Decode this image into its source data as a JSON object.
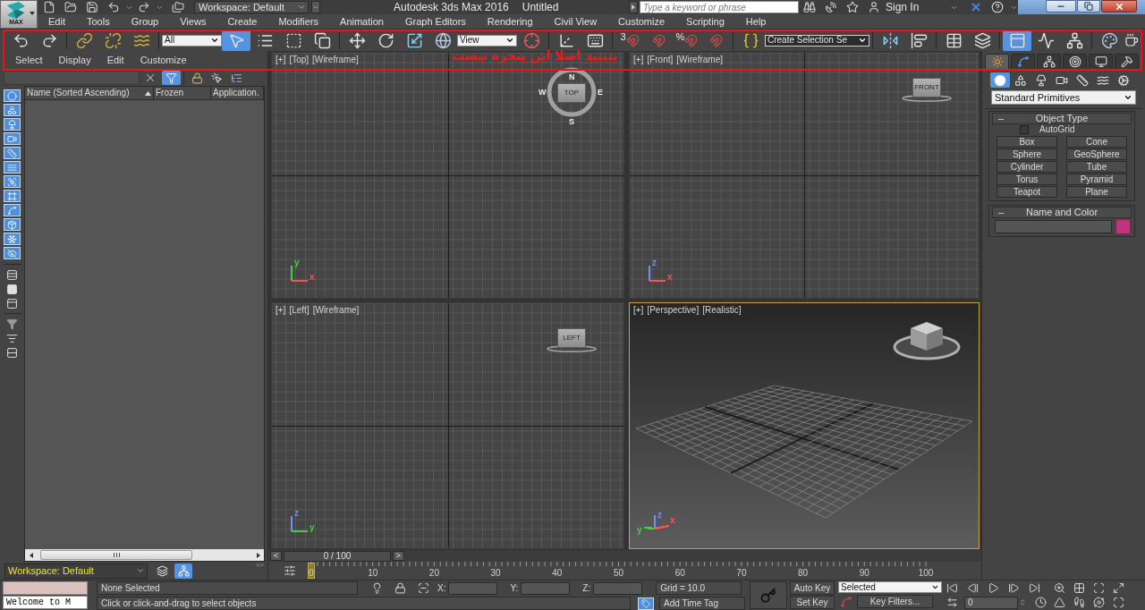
{
  "app_button": {
    "label": "MAX"
  },
  "quick_access": {
    "workspace": "Workspace: Default"
  },
  "title": {
    "app": "Autodesk 3ds Max 2016",
    "document": "Untitled"
  },
  "search": {
    "placeholder": "Type a keyword or phrase"
  },
  "account": {
    "label": "Sign In"
  },
  "menu": [
    "Edit",
    "Tools",
    "Group",
    "Views",
    "Create",
    "Modifiers",
    "Animation",
    "Graph Editors",
    "Rendering",
    "Civil View",
    "Customize",
    "Scripting",
    "Help"
  ],
  "main_toolbar": {
    "tools": [
      {
        "on": false
      },
      {
        "on": false
      },
      {
        "on": false
      },
      {
        "on": false
      },
      {
        "on": false
      },
      {
        "on": true
      },
      {
        "on": false
      },
      {
        "on": false
      },
      {
        "on": false
      },
      {
        "on": false
      },
      {
        "on": false
      },
      {
        "on": false
      },
      {
        "on": false
      },
      {
        "on": false
      },
      {
        "on": false
      },
      {
        "on": false
      },
      {
        "on": false,
        "glyph": "3"
      },
      {
        "on": false
      },
      {
        "on": false,
        "glyph": "%"
      },
      {
        "on": false
      },
      {
        "on": false
      },
      {
        "on": false
      },
      {
        "on": false
      },
      {
        "on": false
      },
      {
        "on": false
      },
      {
        "on": true
      },
      {
        "on": false
      },
      {
        "on": false
      },
      {
        "on": false
      },
      {
        "on": false
      }
    ],
    "dropdowns": [
      "All",
      "View",
      "Create Selection Se"
    ]
  },
  "annotation": {
    "text": "ببینید اصلا این پنجره نیست"
  },
  "scene_explorer": {
    "menu": [
      "Select",
      "Display",
      "Edit",
      "Customize"
    ],
    "tools": [
      {
        "on": false
      },
      {
        "on": true
      },
      {
        "on": false
      },
      {
        "on": false
      },
      {
        "on": false
      }
    ],
    "filters": [
      {
        "on": true
      },
      {
        "on": true
      },
      {
        "on": true
      },
      {
        "on": true
      },
      {
        "on": true
      },
      {
        "on": true
      },
      {
        "on": true
      },
      {
        "on": true
      },
      {
        "on": true
      },
      {
        "on": true
      },
      {
        "on": true
      },
      {
        "on": true
      }
    ],
    "columns": [
      "Name (Sorted Ascending)",
      "Frozen",
      "Application."
    ],
    "workspace": "Workspace: Default",
    "workspace_tools": [
      {
        "on": false
      },
      {
        "on": true
      }
    ],
    "expand": ">>"
  },
  "viewports": [
    {
      "labels": [
        "[+]",
        "[Top]",
        "[Wireframe]"
      ],
      "kind": "grid",
      "active": false,
      "cube": "TOP",
      "compass": [
        "N",
        "E",
        "S",
        "W"
      ],
      "axes": [
        {
          "label": "y",
          "color": "#40d040"
        },
        {
          "label": "x",
          "color": "#ff5050"
        }
      ]
    },
    {
      "labels": [
        "[+]",
        "[Front]",
        "[Wireframe]"
      ],
      "kind": "grid",
      "active": false,
      "cube": "FRONT",
      "axes": [
        {
          "label": "z",
          "color": "#7090ff"
        },
        {
          "label": "x",
          "color": "#ff5050"
        }
      ]
    },
    {
      "labels": [
        "[+]",
        "[Left]",
        "[Wireframe]"
      ],
      "kind": "grid",
      "active": false,
      "cube": "LEFT",
      "axes": [
        {
          "label": "z",
          "color": "#7090ff"
        },
        {
          "label": "y",
          "color": "#40d040"
        }
      ]
    },
    {
      "labels": [
        "[+]",
        "[Perspective]",
        "[Realistic]"
      ],
      "kind": "perspective",
      "active": true,
      "axes": [
        {
          "label": "z",
          "color": "#7090ff"
        },
        {
          "label": "x",
          "color": "#ff5050"
        },
        {
          "label": "y",
          "color": "#40d040"
        }
      ]
    }
  ],
  "time_slider": {
    "prev": "<",
    "position": "0 / 100",
    "next": ">",
    "level": 0
  },
  "track_bar": {
    "labels": [
      "0",
      "10",
      "20",
      "30",
      "40",
      "50",
      "60",
      "70",
      "80",
      "90",
      "100"
    ]
  },
  "command_panel": {
    "tabs": [
      {
        "selected": true
      },
      {
        "selected": false
      },
      {
        "selected": false
      },
      {
        "selected": false
      },
      {
        "selected": false
      },
      {
        "selected": false
      }
    ],
    "categories": [
      {
        "selected": true
      },
      {
        "selected": false
      },
      {
        "selected": false
      },
      {
        "selected": false
      },
      {
        "selected": false
      },
      {
        "selected": false
      },
      {
        "selected": false
      }
    ],
    "category_list": "Standard Primitives",
    "object_type": {
      "toggle": "–",
      "title": "Object Type",
      "autogrid": {
        "label": "AutoGrid",
        "checked": false
      },
      "buttons": [
        "Box",
        "Cone",
        "Sphere",
        "GeoSphere",
        "Cylinder",
        "Tube",
        "Torus",
        "Pyramid",
        "Teapot",
        "Plane"
      ]
    },
    "name_and_color": {
      "toggle": "–",
      "title": "Name and Color",
      "color": "#c2327f"
    }
  },
  "status_bar": {
    "listener_output": "Welcome to M",
    "selection": "None Selected",
    "prompt": "Click or click-and-drag to select objects",
    "coords": [
      "X:",
      "Y:",
      "Z:"
    ],
    "grid": "Grid = 10.0",
    "time_tag": "Add Time Tag",
    "auto_key": "Auto Key",
    "set_key": "Set Key",
    "key_set": "Selected",
    "key_filters": "Key Filters...",
    "frame": "0"
  }
}
